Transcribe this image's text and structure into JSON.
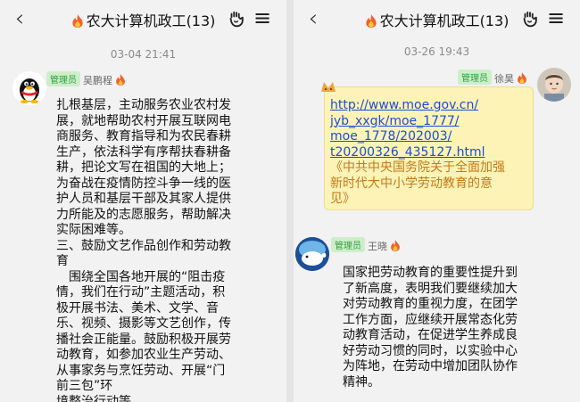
{
  "left": {
    "title": "农大计算机政工(13)",
    "timestamp": "03-04 21:41",
    "sender": {
      "badge": "管理员",
      "name": "吴鹏程"
    },
    "message": "扎根基层，主动服务农业农村发\n展，就地帮助农村开展互联网电\n商服务、教育指导和为农民春耕\n生产，依法科学有序帮扶春耕备\n耕，把论文写在祖国的大地上；\n为奋战在疫情防控斗争一线的医\n护人员和基层干部及其家人提供\n力所能及的志愿服务，帮助解决\n实际困难等。\n三、鼓励文艺作品创作和劳动教\n育\n　围绕全国各地开展的“阻击疫\n情，我们在行动”主题活动，积\n极开展书法、美术、文学、音\n乐、视频、摄影等文艺创作，传\n播社会正能量。鼓励积极开展劳\n动教育，如参加农业生产劳动、\n从事家务与烹饪劳动、开展“门\n前三包”环\n境整治行动等。"
  },
  "right": {
    "title": "农大计算机政工(13)",
    "timestamp": "03-26 19:43",
    "sender1": {
      "badge": "管理员",
      "name": "徐昊"
    },
    "link_lines": [
      "http://www.moe.gov.cn/",
      "jyb_xxgk/moe_1777/",
      "moe_1778/202003/",
      "t20200326_435127.html"
    ],
    "link_desc": "《中共中央国务院关于全面加强\n新时代大中小学劳动教育的意\n见》",
    "sender2": {
      "badge": "管理员",
      "name": "王晓"
    },
    "message2": "国家把劳动教育的重要性提升到\n了新高度，表明我们要继续加大\n对劳动教育的重视力度，在团学\n工作方面，应继续开展常态化劳\n动教育活动，在促进学生养成良\n好劳动习惯的同时，以实验中心\n为阵地，在劳动中增加团队协作\n精神。"
  },
  "icons": {
    "back": "‹",
    "menu": "≡"
  }
}
